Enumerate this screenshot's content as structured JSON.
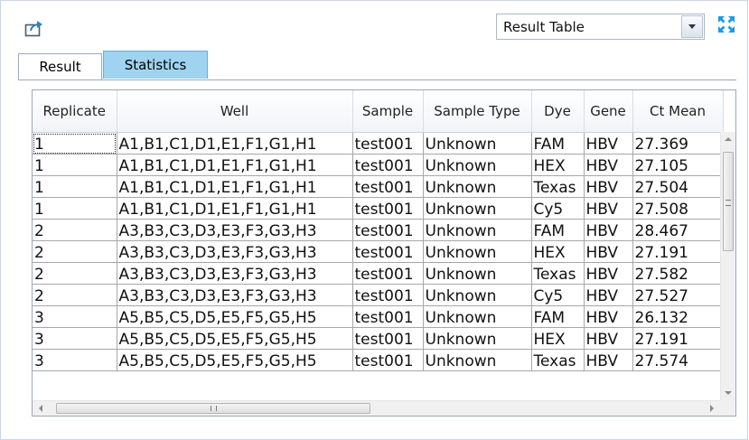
{
  "toolbar": {
    "view_select_value": "Result Table",
    "export_icon": "export-icon",
    "expand_icon": "expand-icon"
  },
  "tabs": [
    {
      "label": "Result",
      "active": false
    },
    {
      "label": "Statistics",
      "active": true
    }
  ],
  "table": {
    "columns": [
      "Replicate",
      "Well",
      "Sample",
      "Sample Type",
      "Dye",
      "Gene",
      "Ct Mean"
    ],
    "rows": [
      [
        "1",
        "A1,B1,C1,D1,E1,F1,G1,H1",
        "test001",
        "Unknown",
        "FAM",
        "HBV",
        "27.369"
      ],
      [
        "1",
        "A1,B1,C1,D1,E1,F1,G1,H1",
        "test001",
        "Unknown",
        "HEX",
        "HBV",
        "27.105"
      ],
      [
        "1",
        "A1,B1,C1,D1,E1,F1,G1,H1",
        "test001",
        "Unknown",
        "Texas",
        "HBV",
        "27.504"
      ],
      [
        "1",
        "A1,B1,C1,D1,E1,F1,G1,H1",
        "test001",
        "Unknown",
        "Cy5",
        "HBV",
        "27.508"
      ],
      [
        "2",
        "A3,B3,C3,D3,E3,F3,G3,H3",
        "test001",
        "Unknown",
        "FAM",
        "HBV",
        "28.467"
      ],
      [
        "2",
        "A3,B3,C3,D3,E3,F3,G3,H3",
        "test001",
        "Unknown",
        "HEX",
        "HBV",
        "27.191"
      ],
      [
        "2",
        "A3,B3,C3,D3,E3,F3,G3,H3",
        "test001",
        "Unknown",
        "Texas",
        "HBV",
        "27.582"
      ],
      [
        "2",
        "A3,B3,C3,D3,E3,F3,G3,H3",
        "test001",
        "Unknown",
        "Cy5",
        "HBV",
        "27.527"
      ],
      [
        "3",
        "A5,B5,C5,D5,E5,F5,G5,H5",
        "test001",
        "Unknown",
        "FAM",
        "HBV",
        "26.132"
      ],
      [
        "3",
        "A5,B5,C5,D5,E5,F5,G5,H5",
        "test001",
        "Unknown",
        "HEX",
        "HBV",
        "27.191"
      ],
      [
        "3",
        "A5,B5,C5,D5,E5,F5,G5,H5",
        "test001",
        "Unknown",
        "Texas",
        "HBV",
        "27.574"
      ]
    ]
  },
  "scroll": {
    "vertical_icons": [
      "scroll-up-icon",
      "grip-icon",
      "scroll-down-icon"
    ],
    "horizontal_icons": [
      "scroll-left-icon",
      "grip-icon",
      "scroll-right-icon"
    ]
  },
  "colors": {
    "active_tab": "#9fd3ef",
    "accent_icon": "#1e9be0"
  }
}
